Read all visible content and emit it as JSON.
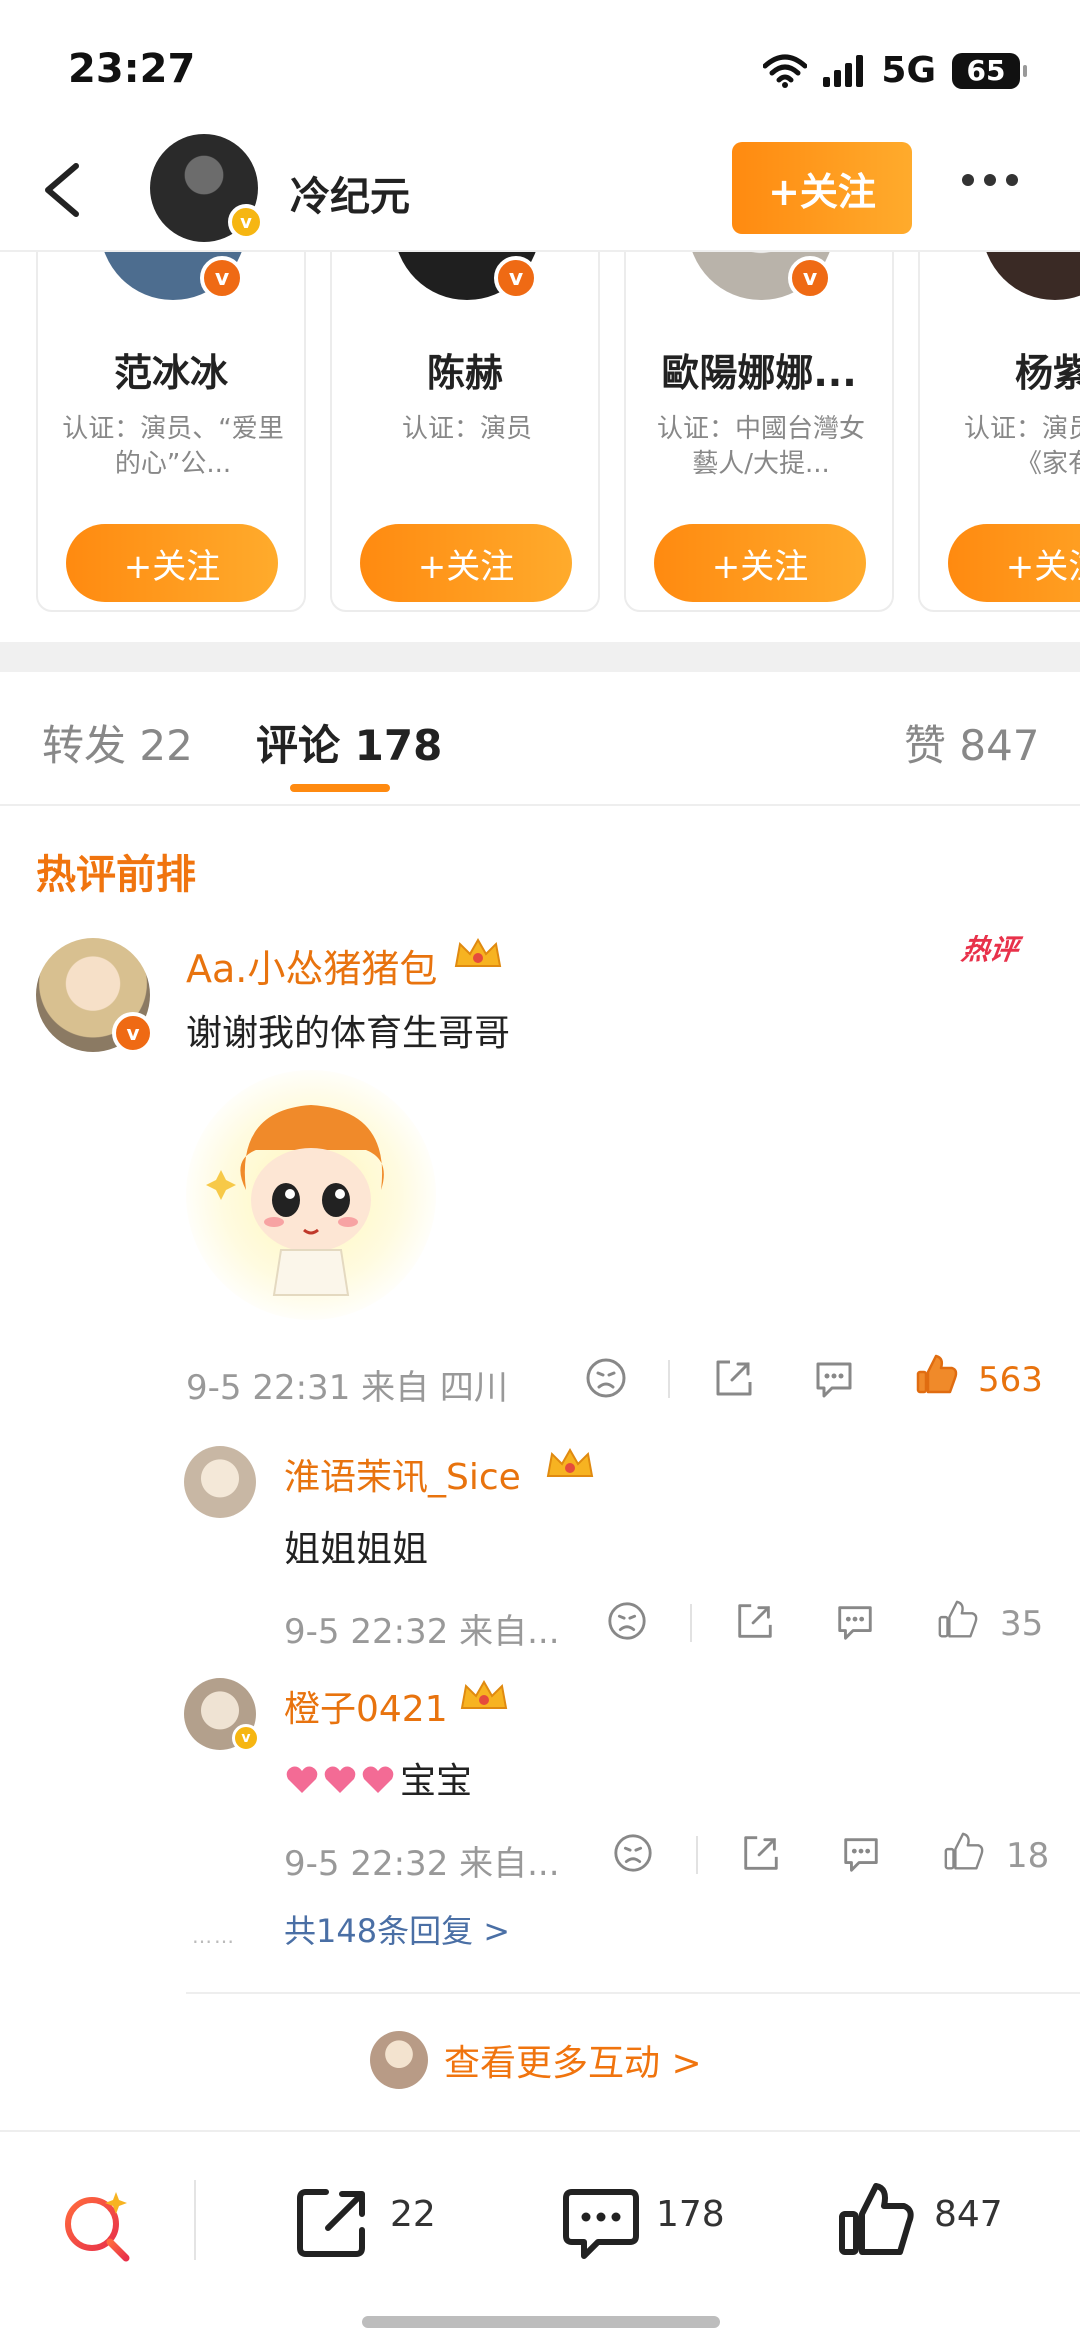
{
  "status_bar": {
    "time": "23:27",
    "network": "5G",
    "battery": "65"
  },
  "header": {
    "name": "冷纪元",
    "follow_label": "+关注"
  },
  "recommend_cards": [
    {
      "name": "范冰冰",
      "desc": "认证：演员、“爱里的心”公...",
      "button": "+关注"
    },
    {
      "name": "陈赫",
      "desc": "认证：演员",
      "button": "+关注"
    },
    {
      "name": "歐陽娜娜...",
      "desc": "认证：中國台灣女藝人/大提...",
      "button": "+关注"
    },
    {
      "name": "杨紫",
      "desc": "认证：演员表作《家有",
      "button": "+关注"
    }
  ],
  "tabs": {
    "repost": "转发 22",
    "comment": "评论 178",
    "like": "赞 847"
  },
  "hot_section": {
    "title": "热评前排",
    "badge": "热评"
  },
  "main_comment": {
    "username": "Aa.小怂猪猪包",
    "text": "谢谢我的体育生哥哥",
    "meta": "9-5 22:31  来自 四川",
    "likes": "563"
  },
  "replies": [
    {
      "username": "淮语茉讯_Sice",
      "text": "姐姐姐姐",
      "meta": "9-5 22:32  来自...",
      "likes": "35"
    },
    {
      "username": "橙子0421",
      "text": "宝宝",
      "meta": "9-5 22:32  来自...",
      "likes": "18"
    }
  ],
  "replies_link": "共148条回复 >",
  "more_interactions": "查看更多互动 >",
  "bottom_bar": {
    "repost_count": "22",
    "comment_count": "178",
    "like_count": "847"
  },
  "colors": {
    "accent": "#ff8a10",
    "username": "#e8730e",
    "hot": "#e8314a"
  }
}
